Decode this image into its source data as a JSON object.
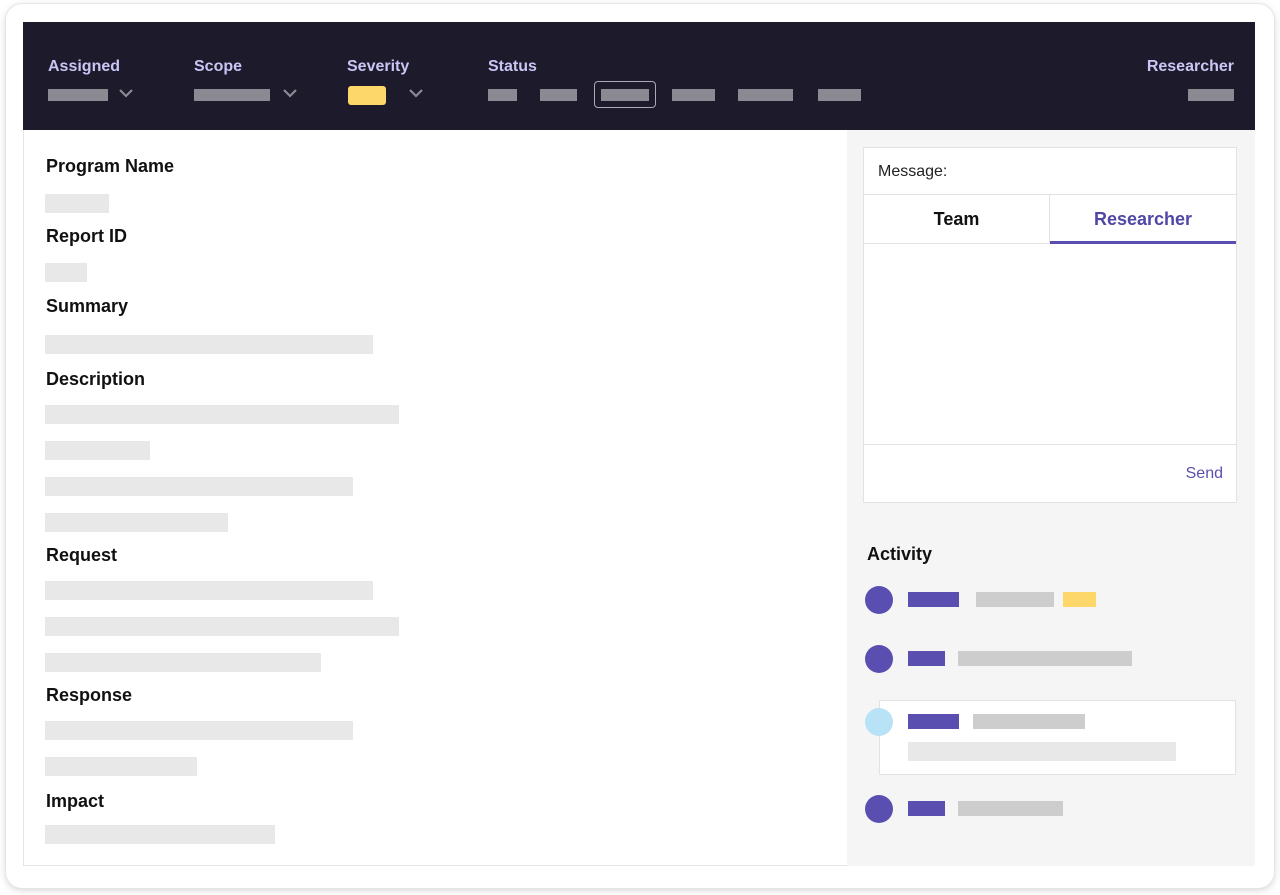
{
  "topbar": {
    "assigned_label": "Assigned",
    "scope_label": "Scope",
    "severity_label": "Severity",
    "status_label": "Status",
    "researcher_label": "Researcher",
    "severity_color": "#fdd76a",
    "selected_status_index": 2
  },
  "report": {
    "headings": {
      "program_name": "Program Name",
      "report_id": "Report ID",
      "summary": "Summary",
      "description": "Description",
      "request": "Request",
      "response": "Response",
      "impact": "Impact"
    }
  },
  "message": {
    "label": "Message:",
    "tabs": [
      "Team",
      "Researcher"
    ],
    "active_tab": "Researcher",
    "send_label": "Send"
  },
  "activity": {
    "title": "Activity"
  },
  "colors": {
    "topbar_bg": "#1c1a2b",
    "accent": "#5a4fb0",
    "highlight": "#fdd76a",
    "light_dot": "#b8e2f5"
  }
}
